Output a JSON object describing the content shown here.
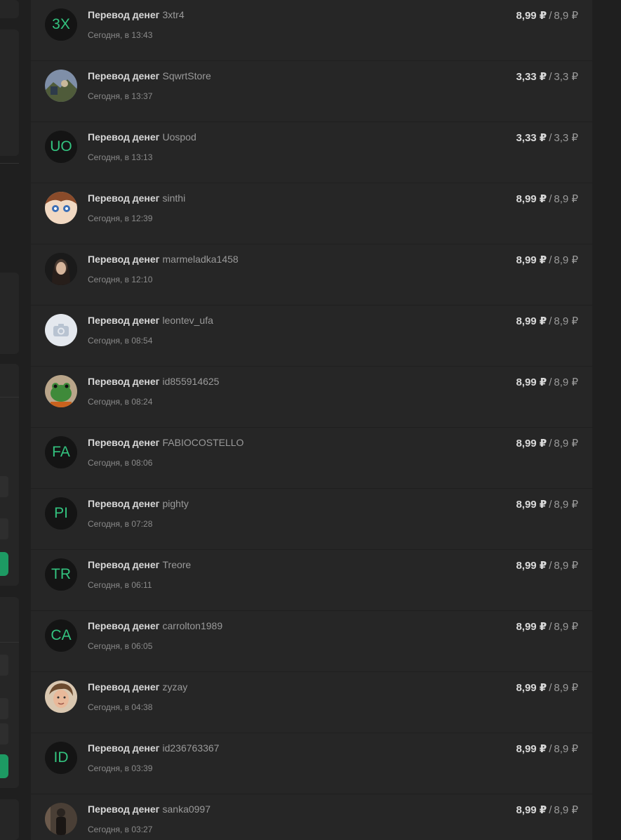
{
  "transactions": [
    {
      "title": "Перевод денег",
      "user": "3xtr4",
      "time": "Сегодня, в 13:43",
      "amount": "8,99 ₽",
      "sub": "8,9 ₽",
      "initials": "3X",
      "avatar": "initials"
    },
    {
      "title": "Перевод денег",
      "user": "SqwrtStore",
      "time": "Сегодня, в 13:37",
      "amount": "3,33 ₽",
      "sub": "3,3 ₽",
      "initials": "",
      "avatar": "photo-landscape"
    },
    {
      "title": "Перевод денег",
      "user": "Uospod",
      "time": "Сегодня, в 13:13",
      "amount": "3,33 ₽",
      "sub": "3,3 ₽",
      "initials": "UO",
      "avatar": "initials"
    },
    {
      "title": "Перевод денег",
      "user": "sinthi",
      "time": "Сегодня, в 12:39",
      "amount": "8,99 ₽",
      "sub": "8,9 ₽",
      "initials": "",
      "avatar": "photo-anime"
    },
    {
      "title": "Перевод денег",
      "user": "marmeladka1458",
      "time": "Сегодня, в 12:10",
      "amount": "8,99 ₽",
      "sub": "8,9 ₽",
      "initials": "",
      "avatar": "photo-dark"
    },
    {
      "title": "Перевод денег",
      "user": "leontev_ufa",
      "time": "Сегодня, в 08:54",
      "amount": "8,99 ₽",
      "sub": "8,9 ₽",
      "initials": "",
      "avatar": "camera"
    },
    {
      "title": "Перевод денег",
      "user": "id855914625",
      "time": "Сегодня, в 08:24",
      "amount": "8,99 ₽",
      "sub": "8,9 ₽",
      "initials": "",
      "avatar": "photo-frog"
    },
    {
      "title": "Перевод денег",
      "user": "FABIOCOSTELLO",
      "time": "Сегодня, в 08:06",
      "amount": "8,99 ₽",
      "sub": "8,9 ₽",
      "initials": "FA",
      "avatar": "initials"
    },
    {
      "title": "Перевод денег",
      "user": "pighty",
      "time": "Сегодня, в 07:28",
      "amount": "8,99 ₽",
      "sub": "8,9 ₽",
      "initials": "PI",
      "avatar": "initials"
    },
    {
      "title": "Перевод денег",
      "user": "Treore",
      "time": "Сегодня, в 06:11",
      "amount": "8,99 ₽",
      "sub": "8,9 ₽",
      "initials": "TR",
      "avatar": "initials"
    },
    {
      "title": "Перевод денег",
      "user": "carrolton1989",
      "time": "Сегодня, в 06:05",
      "amount": "8,99 ₽",
      "sub": "8,9 ₽",
      "initials": "CA",
      "avatar": "initials"
    },
    {
      "title": "Перевод денег",
      "user": "zyzay",
      "time": "Сегодня, в 04:38",
      "amount": "8,99 ₽",
      "sub": "8,9 ₽",
      "initials": "",
      "avatar": "photo-face"
    },
    {
      "title": "Перевод денег",
      "user": "id236763367",
      "time": "Сегодня, в 03:39",
      "amount": "8,99 ₽",
      "sub": "8,9 ₽",
      "initials": "ID",
      "avatar": "initials"
    },
    {
      "title": "Перевод денег",
      "user": "sanka0997",
      "time": "Сегодня, в 03:27",
      "amount": "8,99 ₽",
      "sub": "8,9 ₽",
      "initials": "",
      "avatar": "photo-person"
    }
  ],
  "colors": {
    "background": "#1f1f1f",
    "card": "#262626",
    "accent": "#1d9a63",
    "initials": "#33c37f"
  }
}
